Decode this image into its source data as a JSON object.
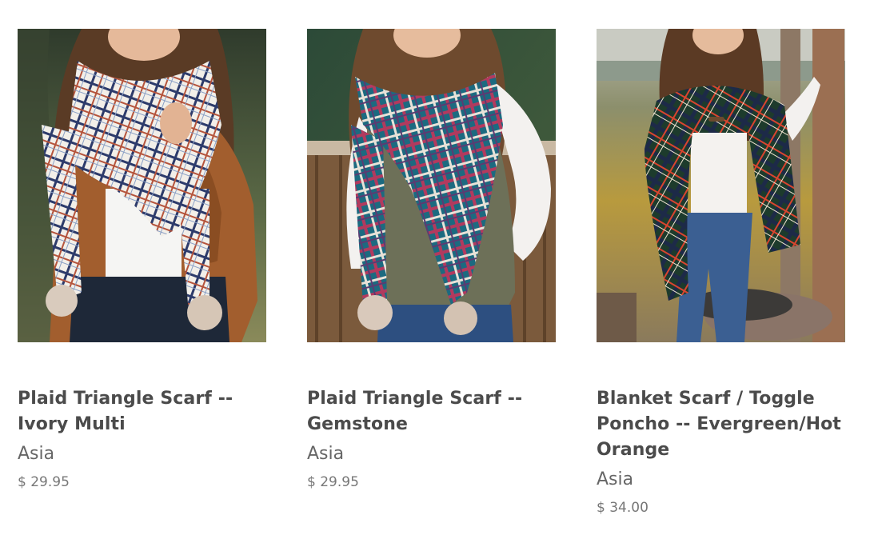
{
  "products": [
    {
      "title": "Plaid Triangle Scarf -- Ivory Multi",
      "vendor": "Asia",
      "price": "$ 29.95",
      "image_alt": "Woman wearing ivory multi plaid triangle scarf with pom-poms and tan suede jacket"
    },
    {
      "title": "Plaid Triangle Scarf -- Gemstone",
      "vendor": "Asia",
      "price": "$ 29.95",
      "image_alt": "Woman wearing teal and pink gemstone plaid triangle scarf with olive vest"
    },
    {
      "title": "Blanket Scarf / Toggle Poncho -- Evergreen/Hot Orange",
      "vendor": "Asia",
      "price": "$ 34.00",
      "image_alt": "Woman wearing evergreen and orange plaid blanket scarf poncho outdoors by a tree"
    }
  ]
}
